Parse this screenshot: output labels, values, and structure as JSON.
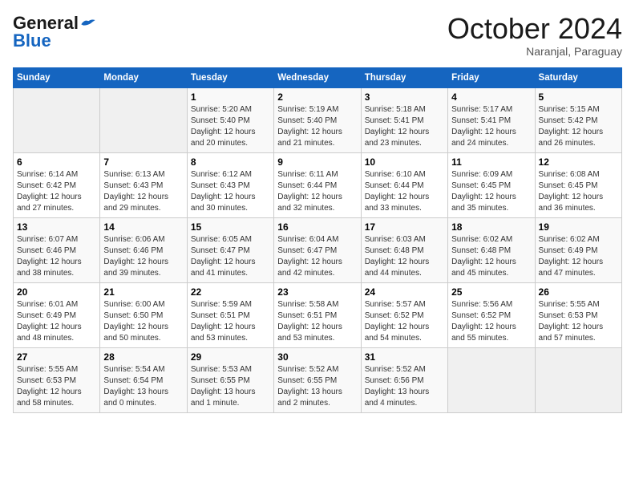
{
  "header": {
    "logo_general": "General",
    "logo_blue": "Blue",
    "month_title": "October 2024",
    "subtitle": "Naranjal, Paraguay"
  },
  "days_of_week": [
    "Sunday",
    "Monday",
    "Tuesday",
    "Wednesday",
    "Thursday",
    "Friday",
    "Saturday"
  ],
  "weeks": [
    [
      {
        "day": "",
        "content": ""
      },
      {
        "day": "",
        "content": ""
      },
      {
        "day": "1",
        "sunrise": "Sunrise: 5:20 AM",
        "sunset": "Sunset: 5:40 PM",
        "daylight": "Daylight: 12 hours and 20 minutes."
      },
      {
        "day": "2",
        "sunrise": "Sunrise: 5:19 AM",
        "sunset": "Sunset: 5:40 PM",
        "daylight": "Daylight: 12 hours and 21 minutes."
      },
      {
        "day": "3",
        "sunrise": "Sunrise: 5:18 AM",
        "sunset": "Sunset: 5:41 PM",
        "daylight": "Daylight: 12 hours and 23 minutes."
      },
      {
        "day": "4",
        "sunrise": "Sunrise: 5:17 AM",
        "sunset": "Sunset: 5:41 PM",
        "daylight": "Daylight: 12 hours and 24 minutes."
      },
      {
        "day": "5",
        "sunrise": "Sunrise: 5:15 AM",
        "sunset": "Sunset: 5:42 PM",
        "daylight": "Daylight: 12 hours and 26 minutes."
      }
    ],
    [
      {
        "day": "6",
        "sunrise": "Sunrise: 6:14 AM",
        "sunset": "Sunset: 6:42 PM",
        "daylight": "Daylight: 12 hours and 27 minutes."
      },
      {
        "day": "7",
        "sunrise": "Sunrise: 6:13 AM",
        "sunset": "Sunset: 6:43 PM",
        "daylight": "Daylight: 12 hours and 29 minutes."
      },
      {
        "day": "8",
        "sunrise": "Sunrise: 6:12 AM",
        "sunset": "Sunset: 6:43 PM",
        "daylight": "Daylight: 12 hours and 30 minutes."
      },
      {
        "day": "9",
        "sunrise": "Sunrise: 6:11 AM",
        "sunset": "Sunset: 6:44 PM",
        "daylight": "Daylight: 12 hours and 32 minutes."
      },
      {
        "day": "10",
        "sunrise": "Sunrise: 6:10 AM",
        "sunset": "Sunset: 6:44 PM",
        "daylight": "Daylight: 12 hours and 33 minutes."
      },
      {
        "day": "11",
        "sunrise": "Sunrise: 6:09 AM",
        "sunset": "Sunset: 6:45 PM",
        "daylight": "Daylight: 12 hours and 35 minutes."
      },
      {
        "day": "12",
        "sunrise": "Sunrise: 6:08 AM",
        "sunset": "Sunset: 6:45 PM",
        "daylight": "Daylight: 12 hours and 36 minutes."
      }
    ],
    [
      {
        "day": "13",
        "sunrise": "Sunrise: 6:07 AM",
        "sunset": "Sunset: 6:46 PM",
        "daylight": "Daylight: 12 hours and 38 minutes."
      },
      {
        "day": "14",
        "sunrise": "Sunrise: 6:06 AM",
        "sunset": "Sunset: 6:46 PM",
        "daylight": "Daylight: 12 hours and 39 minutes."
      },
      {
        "day": "15",
        "sunrise": "Sunrise: 6:05 AM",
        "sunset": "Sunset: 6:47 PM",
        "daylight": "Daylight: 12 hours and 41 minutes."
      },
      {
        "day": "16",
        "sunrise": "Sunrise: 6:04 AM",
        "sunset": "Sunset: 6:47 PM",
        "daylight": "Daylight: 12 hours and 42 minutes."
      },
      {
        "day": "17",
        "sunrise": "Sunrise: 6:03 AM",
        "sunset": "Sunset: 6:48 PM",
        "daylight": "Daylight: 12 hours and 44 minutes."
      },
      {
        "day": "18",
        "sunrise": "Sunrise: 6:02 AM",
        "sunset": "Sunset: 6:48 PM",
        "daylight": "Daylight: 12 hours and 45 minutes."
      },
      {
        "day": "19",
        "sunrise": "Sunrise: 6:02 AM",
        "sunset": "Sunset: 6:49 PM",
        "daylight": "Daylight: 12 hours and 47 minutes."
      }
    ],
    [
      {
        "day": "20",
        "sunrise": "Sunrise: 6:01 AM",
        "sunset": "Sunset: 6:49 PM",
        "daylight": "Daylight: 12 hours and 48 minutes."
      },
      {
        "day": "21",
        "sunrise": "Sunrise: 6:00 AM",
        "sunset": "Sunset: 6:50 PM",
        "daylight": "Daylight: 12 hours and 50 minutes."
      },
      {
        "day": "22",
        "sunrise": "Sunrise: 5:59 AM",
        "sunset": "Sunset: 6:51 PM",
        "daylight": "Daylight: 12 hours and 53 minutes."
      },
      {
        "day": "23",
        "sunrise": "Sunrise: 5:58 AM",
        "sunset": "Sunset: 6:51 PM",
        "daylight": "Daylight: 12 hours and 53 minutes."
      },
      {
        "day": "24",
        "sunrise": "Sunrise: 5:57 AM",
        "sunset": "Sunset: 6:52 PM",
        "daylight": "Daylight: 12 hours and 54 minutes."
      },
      {
        "day": "25",
        "sunrise": "Sunrise: 5:56 AM",
        "sunset": "Sunset: 6:52 PM",
        "daylight": "Daylight: 12 hours and 55 minutes."
      },
      {
        "day": "26",
        "sunrise": "Sunrise: 5:55 AM",
        "sunset": "Sunset: 6:53 PM",
        "daylight": "Daylight: 12 hours and 57 minutes."
      }
    ],
    [
      {
        "day": "27",
        "sunrise": "Sunrise: 5:55 AM",
        "sunset": "Sunset: 6:53 PM",
        "daylight": "Daylight: 12 hours and 58 minutes."
      },
      {
        "day": "28",
        "sunrise": "Sunrise: 5:54 AM",
        "sunset": "Sunset: 6:54 PM",
        "daylight": "Daylight: 13 hours and 0 minutes."
      },
      {
        "day": "29",
        "sunrise": "Sunrise: 5:53 AM",
        "sunset": "Sunset: 6:55 PM",
        "daylight": "Daylight: 13 hours and 1 minute."
      },
      {
        "day": "30",
        "sunrise": "Sunrise: 5:52 AM",
        "sunset": "Sunset: 6:55 PM",
        "daylight": "Daylight: 13 hours and 2 minutes."
      },
      {
        "day": "31",
        "sunrise": "Sunrise: 5:52 AM",
        "sunset": "Sunset: 6:56 PM",
        "daylight": "Daylight: 13 hours and 4 minutes."
      },
      {
        "day": "",
        "content": ""
      },
      {
        "day": "",
        "content": ""
      }
    ]
  ]
}
